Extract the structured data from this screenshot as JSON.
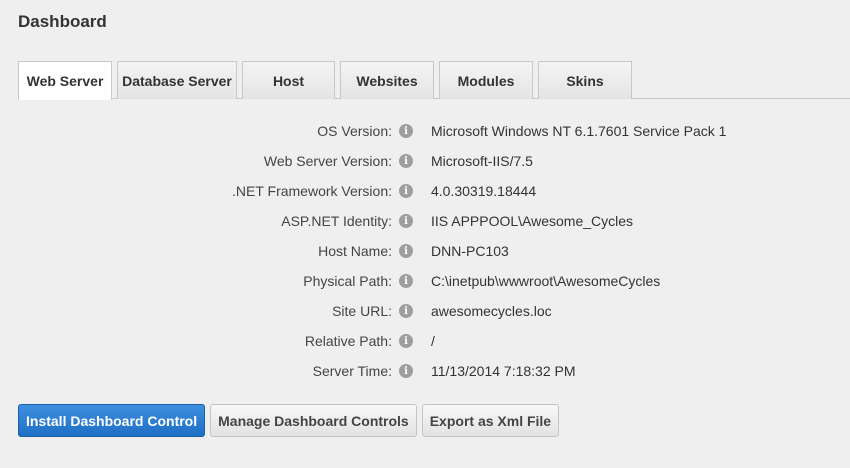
{
  "page": {
    "title": "Dashboard"
  },
  "tabs": [
    {
      "label": "Web Server",
      "active": true
    },
    {
      "label": "Database Server",
      "active": false
    },
    {
      "label": "Host",
      "active": false
    },
    {
      "label": "Websites",
      "active": false
    },
    {
      "label": "Modules",
      "active": false
    },
    {
      "label": "Skins",
      "active": false
    }
  ],
  "info": [
    {
      "label": "OS Version:",
      "value": "Microsoft Windows NT 6.1.7601 Service Pack 1"
    },
    {
      "label": "Web Server Version:",
      "value": "Microsoft-IIS/7.5"
    },
    {
      "label": ".NET Framework Version:",
      "value": "4.0.30319.18444"
    },
    {
      "label": "ASP.NET Identity:",
      "value": "IIS APPPOOL\\Awesome_Cycles"
    },
    {
      "label": "Host Name:",
      "value": "DNN-PC103"
    },
    {
      "label": "Physical Path:",
      "value": "C:\\inetpub\\wwwroot\\AwesomeCycles"
    },
    {
      "label": "Site URL:",
      "value": "awesomecycles.loc"
    },
    {
      "label": "Relative Path:",
      "value": "/"
    },
    {
      "label": "Server Time:",
      "value": "11/13/2014 7:18:32 PM"
    }
  ],
  "info_icon": {
    "name": "info-icon",
    "glyph": "i"
  },
  "actions": {
    "install_label": "Install Dashboard Control",
    "manage_label": "Manage Dashboard Controls",
    "export_label": "Export as Xml File"
  },
  "colors": {
    "primary_button": "#2b7fd6",
    "background": "#efefef"
  }
}
